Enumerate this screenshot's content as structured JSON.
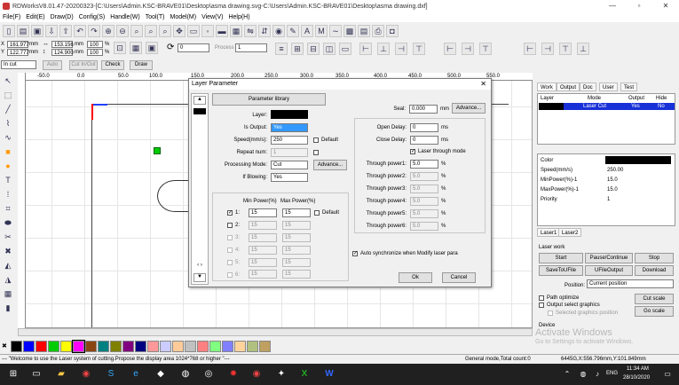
{
  "window": {
    "title": "RDWorksV8.01.47-20200323-[C:\\Users\\Admin.KSC-BRAVE01\\Desktop\\asma drawing.svg-C:\\Users\\Admin.KSC-BRAVE01\\Desktop\\asma drawing.dxf]",
    "min": "—",
    "max": "▫",
    "close": "✕"
  },
  "menu": [
    "File(F)",
    "Edit(E)",
    "Draw(D)",
    "Config(S)",
    "Handle(W)",
    "Tool(T)",
    "Model(M)",
    "View(V)",
    "Help(H)"
  ],
  "coords": {
    "x_label": "X",
    "x_val": "161.977",
    "y_label": "Y",
    "y_val": "122.777",
    "unit": "mm",
    "w_val": "153.156",
    "h_val": "124.900",
    "w_unit": "mm",
    "h_unit": "mm",
    "pct1": "100",
    "pct2": "100",
    "pct_unit": "%",
    "rotate": "0",
    "process_no_label": "Process NO:",
    "process_no": "1"
  },
  "modebar": {
    "mode": "In cut",
    "auto": "Auto",
    "cut_inout": "Cut In/Out",
    "check": "Check",
    "draw": "Draw"
  },
  "ruler_ticks": [
    "-50.0",
    "0.0",
    "50.0",
    "100.0",
    "150.0",
    "200.0",
    "250.0",
    "300.0",
    "350.0",
    "400.0",
    "450.0",
    "500.0",
    "550.0"
  ],
  "dialog": {
    "title": "Layer Parameter",
    "close": "✕",
    "library_btn": "Parameter library",
    "layer_label": "Layer:",
    "is_output_label": "Is Output:",
    "is_output": "Yes",
    "speed_label": "Speed(mm/s):",
    "speed": "250",
    "default_label": "Default",
    "repeat_label": "Repeat num:",
    "repeat": "1",
    "mode_label": "Processing Mode:",
    "mode": "Cut",
    "advance": "Advance...",
    "blowing_label": "If Blowing:",
    "blowing": "Yes",
    "power_head_min": "Min Power(%)",
    "power_head_max": "Max Power(%)",
    "powers": [
      {
        "idx": "1:",
        "min": "15",
        "max": "15",
        "on": true
      },
      {
        "idx": "2:",
        "min": "15",
        "max": "15",
        "on": false
      },
      {
        "idx": "3:",
        "min": "15",
        "max": "15",
        "on": false
      },
      {
        "idx": "4:",
        "min": "15",
        "max": "15",
        "on": false
      },
      {
        "idx": "5:",
        "min": "15",
        "max": "15",
        "on": false
      },
      {
        "idx": "6:",
        "min": "15",
        "max": "15",
        "on": false
      }
    ],
    "power_default": "Default",
    "seal_label": "Seal:",
    "seal": "0.000",
    "seal_unit": "mm",
    "seal_advance": "Advance...",
    "open_delay_label": "Open Delay:",
    "open_delay": "0",
    "close_delay_label": "Close Delay:",
    "close_delay": "0",
    "ms": "ms",
    "through_label": "Laser through mode",
    "through": [
      {
        "label": "Through power1:",
        "val": "5.0"
      },
      {
        "label": "Through power2:",
        "val": "5.0"
      },
      {
        "label": "Through power3:",
        "val": "5.0"
      },
      {
        "label": "Through power4:",
        "val": "5.0"
      },
      {
        "label": "Through power5:",
        "val": "5.0"
      },
      {
        "label": "Through power6:",
        "val": "5.0"
      }
    ],
    "pct": "%",
    "auto_sync": "Auto synchronize when Modify laser para",
    "ok": "Ok",
    "cancel": "Cancel"
  },
  "right": {
    "tabs": [
      "Work",
      "Output",
      "Doc",
      "User",
      "Test"
    ],
    "headers": [
      "Layer",
      "Mode",
      "Output",
      "Hide"
    ],
    "row": {
      "mode": "Laser Cut",
      "output": "Yes",
      "hide": "No"
    },
    "props": [
      {
        "k": "Color",
        "v": ""
      },
      {
        "k": "Speed(mm/s)",
        "v": "250.00"
      },
      {
        "k": "MinPower(%)-1",
        "v": "15.0"
      },
      {
        "k": "MaxPower(%)-1",
        "v": "15.0"
      },
      {
        "k": "Priority",
        "v": "1"
      }
    ],
    "layer_tabs": [
      "Laser1",
      "Laser2"
    ],
    "work_label": "Laser work",
    "start": "Start",
    "pause": "Pause/Continue",
    "stop": "Stop",
    "save_ufile": "SaveToUFile",
    "ufile_output": "UFileOutput",
    "download": "Download",
    "position_label": "Position:",
    "position": "Current position",
    "path_opt": "Path optimize",
    "output_sel": "Output select graphics",
    "sel_pos": "Selected graphics position",
    "cut_scale": "Cut scale",
    "go_scale": "Go scale",
    "device": "Device",
    "activate1": "Activate Windows",
    "activate2": "Go to Settings to activate Windows."
  },
  "palette": [
    "#000000",
    "#0000ff",
    "#ff0000",
    "#00cc00",
    "#ffff00",
    "#ff00ff",
    "#8b4513",
    "#008080",
    "#808000",
    "#800080",
    "#000080",
    "#ff9999",
    "#ccccff",
    "#ffcc99",
    "#c0c0c0",
    "#ff8080",
    "#80ff80",
    "#8080ff",
    "#ffd39b",
    "#b0c080",
    "#c0a060"
  ],
  "status": {
    "msg": "--- \"Welcome to use the Laser system of cutting.Propose the display area 1024*768 or higher \"---",
    "mode": "General mode,Total count:0",
    "coords": "6445G,X:556.796mm,Y:101.849mm"
  },
  "taskbar": {
    "time": "11:34 AM",
    "date": "28/10/2020",
    "lang": "ENG"
  }
}
